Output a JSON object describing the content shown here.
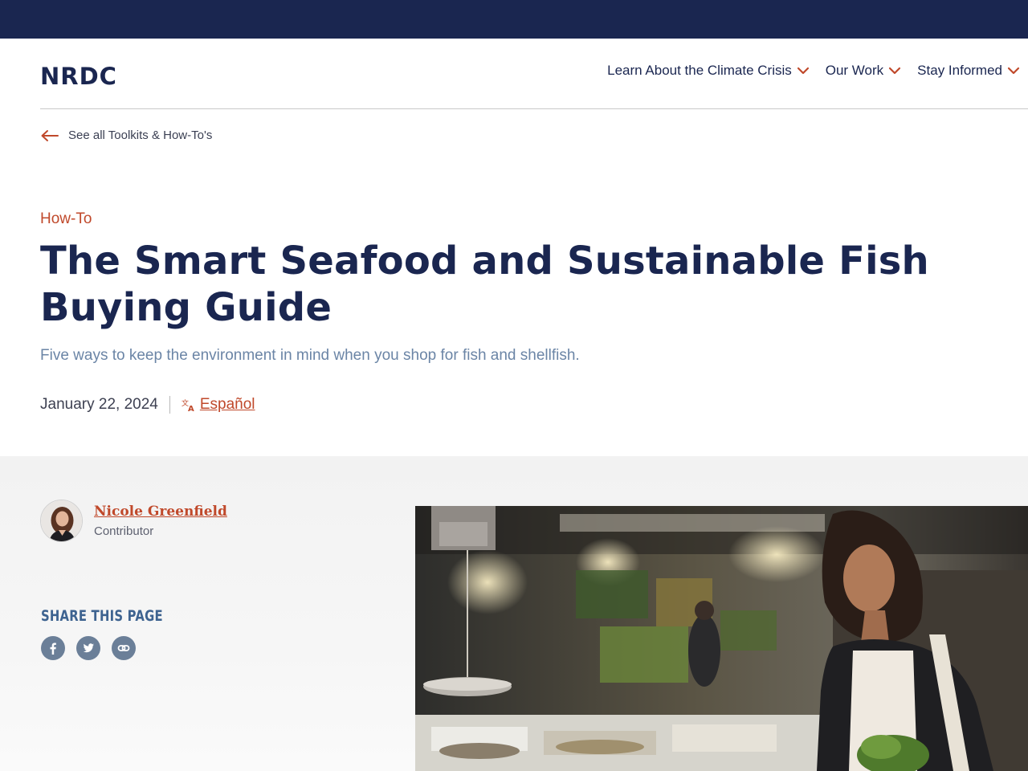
{
  "site": {
    "logo": "NRDC"
  },
  "nav": {
    "items": [
      {
        "label": "Learn About the Climate Crisis"
      },
      {
        "label": "Our Work"
      },
      {
        "label": "Stay Informed"
      }
    ]
  },
  "back_link": {
    "label": "See all Toolkits & How-To's"
  },
  "article": {
    "eyebrow": "How-To",
    "title": "The Smart Seafood and Sustainable Fish Buying Guide",
    "subtitle": "Five ways to keep the environment in mind when you shop for fish and shellfish.",
    "date": "January 22, 2024",
    "language_link": "Español"
  },
  "author": {
    "name": "Nicole Greenfield",
    "role": "Contributor"
  },
  "share": {
    "title": "SHARE THIS PAGE",
    "icons": [
      "facebook-icon",
      "twitter-icon",
      "link-icon"
    ]
  },
  "colors": {
    "navy": "#1a2650",
    "accent": "#c0492b",
    "muted_blue": "#6b85a6",
    "share_blue": "#3e6390"
  }
}
